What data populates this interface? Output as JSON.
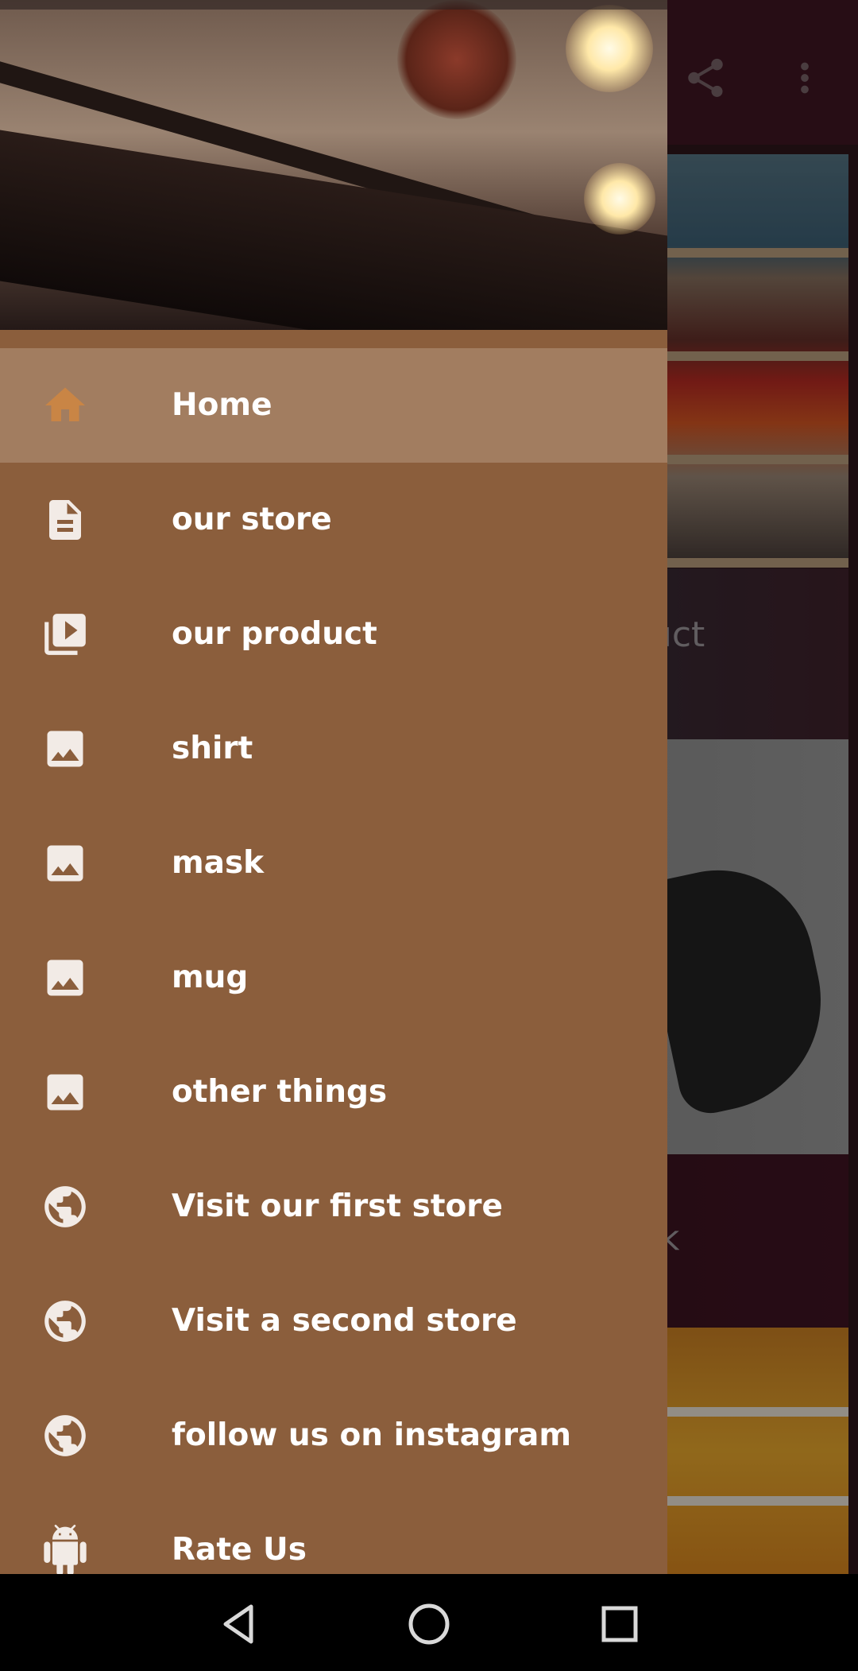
{
  "colors": {
    "drawer_bg": "#8b5e3c",
    "active_item_bg": "#a27d60",
    "active_icon": "#c98545",
    "icon": "#f2ebe6",
    "label": "#ffffff",
    "toolbar": "#3a1420"
  },
  "toolbar": {
    "icons": [
      "share-icon",
      "more-vert-icon"
    ]
  },
  "background": {
    "product_label_fragment": "duct",
    "mug_label_fragment": "k"
  },
  "drawer": {
    "items": [
      {
        "label": "Home",
        "icon": "home-icon",
        "active": true
      },
      {
        "label": "our store",
        "icon": "document-icon",
        "active": false
      },
      {
        "label": "our product",
        "icon": "video-library-icon",
        "active": false
      },
      {
        "label": "shirt",
        "icon": "image-icon",
        "active": false
      },
      {
        "label": "mask",
        "icon": "image-icon",
        "active": false
      },
      {
        "label": "mug",
        "icon": "image-icon",
        "active": false
      },
      {
        "label": "other things",
        "icon": "image-icon",
        "active": false
      },
      {
        "label": "Visit our first store",
        "icon": "globe-icon",
        "active": false
      },
      {
        "label": "Visit a second store",
        "icon": "globe-icon",
        "active": false
      },
      {
        "label": "follow us on instagram",
        "icon": "globe-icon",
        "active": false
      },
      {
        "label": "Rate Us",
        "icon": "android-icon",
        "active": false
      }
    ]
  },
  "system_nav": {
    "buttons": [
      "back-icon",
      "home-circle-icon",
      "recents-icon"
    ]
  }
}
